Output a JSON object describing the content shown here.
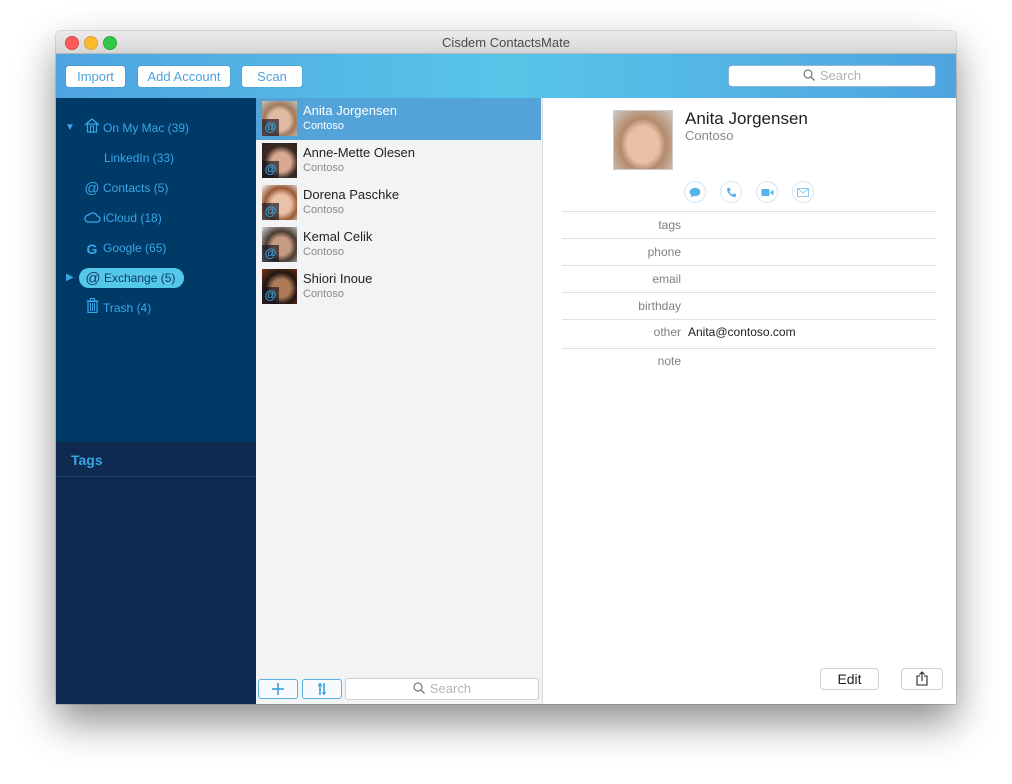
{
  "window": {
    "title": "Cisdem ContactsMate"
  },
  "toolbar": {
    "import_label": "Import",
    "add_account_label": "Add Account",
    "scan_label": "Scan",
    "search_placeholder": "Search"
  },
  "sidebar": {
    "accounts": [
      {
        "label": "On My Mac (39)",
        "icon": "house-icon",
        "expanded": true
      },
      {
        "label": "LinkedIn (33)",
        "icon": "",
        "child": true
      },
      {
        "label": "Contacts (5)",
        "icon": "at-icon"
      },
      {
        "label": "iCloud (18)",
        "icon": "cloud-icon"
      },
      {
        "label": "Google (65)",
        "icon": "google-icon"
      },
      {
        "label": "Exchange (5)",
        "icon": "at-icon",
        "selected": true,
        "expanded": false
      },
      {
        "label": "Trash (4)",
        "icon": "trash-icon"
      }
    ],
    "tags_header": "Tags"
  },
  "contacts": [
    {
      "name": "Anita Jorgensen",
      "org": "Contoso",
      "selected": true,
      "badge": "@"
    },
    {
      "name": "Anne-Mette Olesen",
      "org": "Contoso",
      "badge": "@"
    },
    {
      "name": "Dorena Paschke",
      "org": "Contoso",
      "badge": "@"
    },
    {
      "name": "Kemal Celik",
      "org": "Contoso",
      "badge": "@"
    },
    {
      "name": "Shiori Inoue",
      "org": "Contoso",
      "badge": "@"
    }
  ],
  "list_footer": {
    "add_icon": "plus-icon",
    "sort_icon": "sort-icon",
    "search_placeholder": "Search"
  },
  "detail": {
    "name": "Anita Jorgensen",
    "org": "Contoso",
    "actions": [
      "message-icon",
      "phone-icon",
      "video-icon",
      "mail-icon"
    ],
    "fields": [
      {
        "label": "tags",
        "value": ""
      },
      {
        "label": "phone",
        "value": ""
      },
      {
        "label": "email",
        "value": ""
      },
      {
        "label": "birthday",
        "value": ""
      },
      {
        "label": "other",
        "value": "Anita@contoso.com"
      },
      {
        "label": "note",
        "value": ""
      }
    ],
    "edit_label": "Edit",
    "share_icon": "share-icon"
  },
  "colors": {
    "toolbar_accent": "#53b4e6",
    "sidebar_bg": "#003a67",
    "tags_bg": "#0e2a50",
    "selection": "#53a3d9",
    "sidebar_text": "#3aa6e8",
    "sidebar_selected_pill": "#55c8ea"
  }
}
